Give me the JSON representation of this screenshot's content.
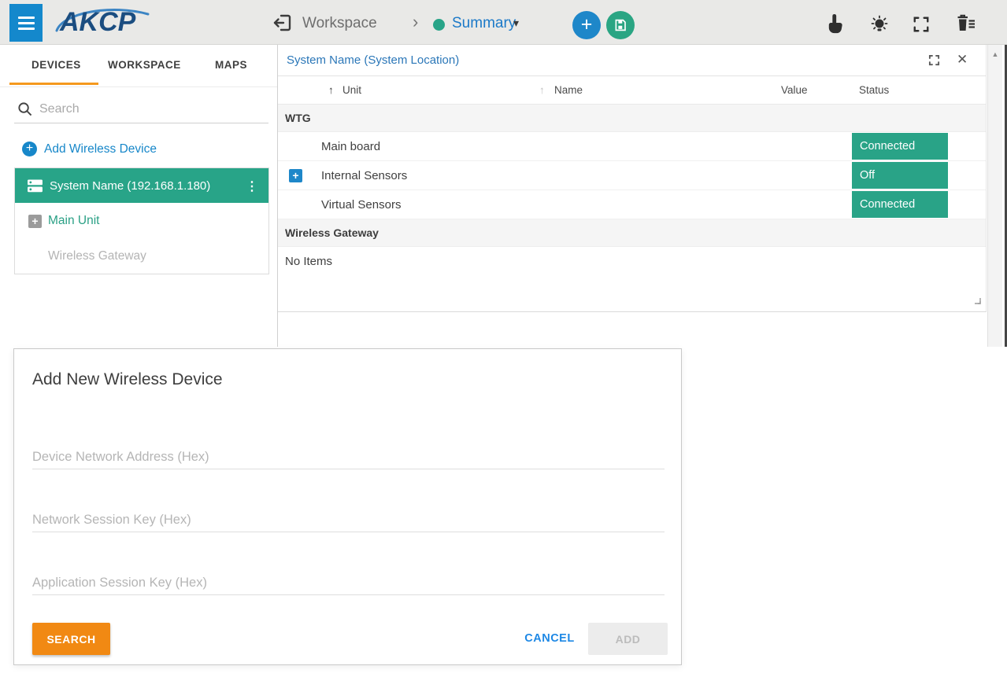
{
  "topbar": {
    "logo_text": "AKCP",
    "breadcrumb": {
      "parent": "Workspace",
      "current": "Summary"
    },
    "icons": [
      "menu",
      "exit-workspace",
      "status-dot",
      "add-circle",
      "save",
      "touch-tool",
      "highlight-bulb",
      "fullscreen",
      "trash-list"
    ]
  },
  "sidebar": {
    "tabs": [
      {
        "label": "DEVICES",
        "active": true
      },
      {
        "label": "WORKSPACE",
        "active": false
      },
      {
        "label": "MAPS",
        "active": false
      }
    ],
    "search": {
      "placeholder": "Search",
      "value": ""
    },
    "add_wireless_device_label": "Add Wireless Device",
    "tree": {
      "device_label": "System Name (192.168.1.180)",
      "main_unit_label": "Main Unit",
      "wireless_gateway_label": "Wireless Gateway"
    }
  },
  "panel": {
    "title": "System Name (System Location)",
    "columns": {
      "unit": "Unit",
      "name": "Name",
      "value": "Value",
      "status": "Status"
    },
    "groups": [
      {
        "label": "WTG",
        "rows": [
          {
            "name": "Main board",
            "value": "",
            "status": "Connected",
            "expandable": false
          },
          {
            "name": "Internal Sensors",
            "value": "",
            "status": "Off",
            "expandable": true
          },
          {
            "name": "Virtual Sensors",
            "value": "",
            "status": "Connected",
            "expandable": false
          }
        ]
      },
      {
        "label": "Wireless Gateway",
        "empty_text": "No Items",
        "rows": []
      }
    ]
  },
  "modal": {
    "title": "Add New Wireless Device",
    "fields": [
      {
        "placeholder": "Device Network Address (Hex)",
        "value": ""
      },
      {
        "placeholder": "Network Session Key (Hex)",
        "value": ""
      },
      {
        "placeholder": "Application Session Key (Hex)",
        "value": ""
      }
    ],
    "buttons": {
      "search": "SEARCH",
      "cancel": "CANCEL",
      "add": "ADD"
    }
  },
  "glyphs": {
    "chevron_right": "›",
    "caret_down": "▾",
    "kebab": "⋮",
    "sort_asc": "↑",
    "close": "✕",
    "scroll_up": "▲",
    "plus": "+"
  },
  "colors": {
    "accent_blue": "#1787c9",
    "link_blue": "#1b79c8",
    "teal_green": "#28a488",
    "orange": "#f18913",
    "topbar_gray": "#e9e9e7"
  }
}
